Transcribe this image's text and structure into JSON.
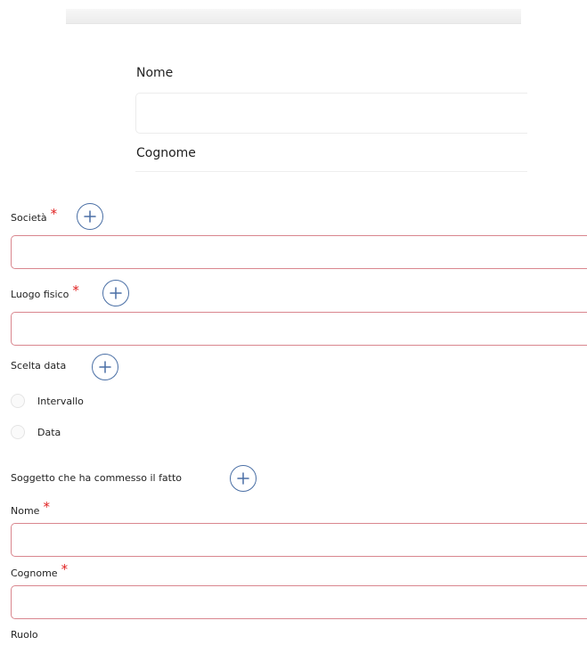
{
  "upper_form": {
    "nome_label": "Nome",
    "cognome_label": "Cognome"
  },
  "fields": {
    "societa_label": "Società",
    "luogo_label": "Luogo fisico",
    "scelta_data_label": "Scelta data",
    "soggetto_label": "Soggetto che ha commesso il fatto",
    "nome_label": "Nome",
    "cognome_label": "Cognome",
    "ruolo_label": "Ruolo"
  },
  "required_marker": "*",
  "radio_options": [
    "Intervallo",
    "Data"
  ],
  "icons": {
    "add": "plus-icon"
  },
  "colors": {
    "required": "#e02020",
    "invalid_border": "#d9868e",
    "accent": "#4a6fa5"
  }
}
